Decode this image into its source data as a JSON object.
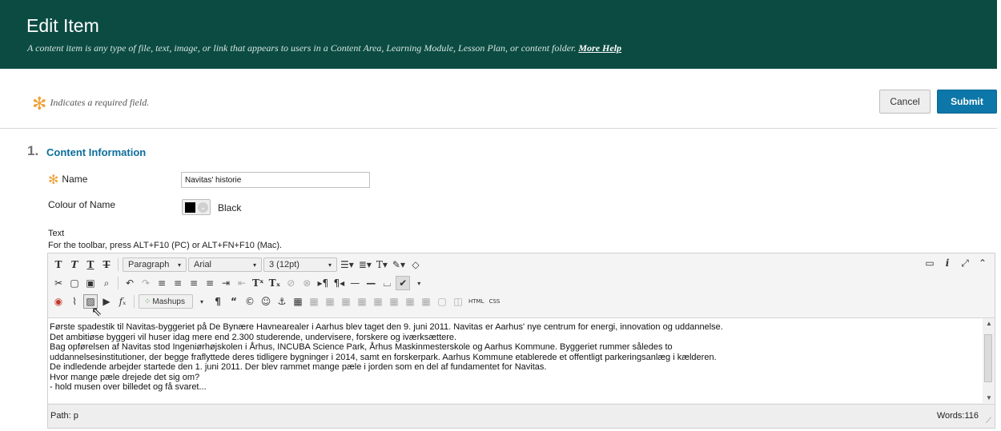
{
  "header": {
    "title": "Edit Item",
    "description": "A content item is any type of file, text, image, or link that appears to users in a Content Area, Learning Module, Lesson Plan, or content folder.",
    "help_link": "More Help",
    "background": "#0b4b42"
  },
  "required_note": "Indicates a required field.",
  "buttons": {
    "cancel": "Cancel",
    "submit": "Submit",
    "submit_color": "#0c77a8"
  },
  "section": {
    "number": "1.",
    "title": "Content Information"
  },
  "fields": {
    "name_label": "Name",
    "name_value": "Navitas' historie",
    "colour_label": "Colour of Name",
    "colour_value": "Black",
    "text_label": "Text",
    "toolbar_hint": "For the toolbar, press ALT+F10 (PC) or ALT+FN+F10 (Mac)."
  },
  "editor": {
    "format_select": "Paragraph",
    "font_select": "Arial",
    "size_select": "3 (12pt)",
    "mashups_label": "Mashups",
    "html_label": "HTML",
    "css_label": "CSS",
    "content_lines": [
      "Første spadestik til Navitas-byggeriet på De Bynære Havnearealer i Aarhus blev taget den 9. juni 2011. Navitas er Aarhus' nye centrum for energi, innovation og uddannelse.",
      "Det ambitiøse byggeri vil huser idag mere end 2.300 studerende, undervisere, forskere og iværksættere.",
      "Bag opførelsen af Navitas stod Ingeniørhøjskolen i Århus, INCUBA Science Park, Århus Maskinmesterskole og Aarhus Kommune. Byggeriet rummer således to",
      "uddannelsesinstitutioner, der begge fraflyttede deres tidligere bygninger i 2014, samt en forskerpark. Aarhus Kommune etablerede et offentligt parkeringsanlæg i kælderen.",
      "De indledende arbejder startede den 1. juni 2011. Der blev rammet mange pæle i jorden som en del af fundamentet for Navitas.",
      "Hvor mange pæle drejede det sig om?",
      "- hold musen over billedet og få svaret..."
    ],
    "path": "Path: p",
    "words": "Words:116"
  }
}
